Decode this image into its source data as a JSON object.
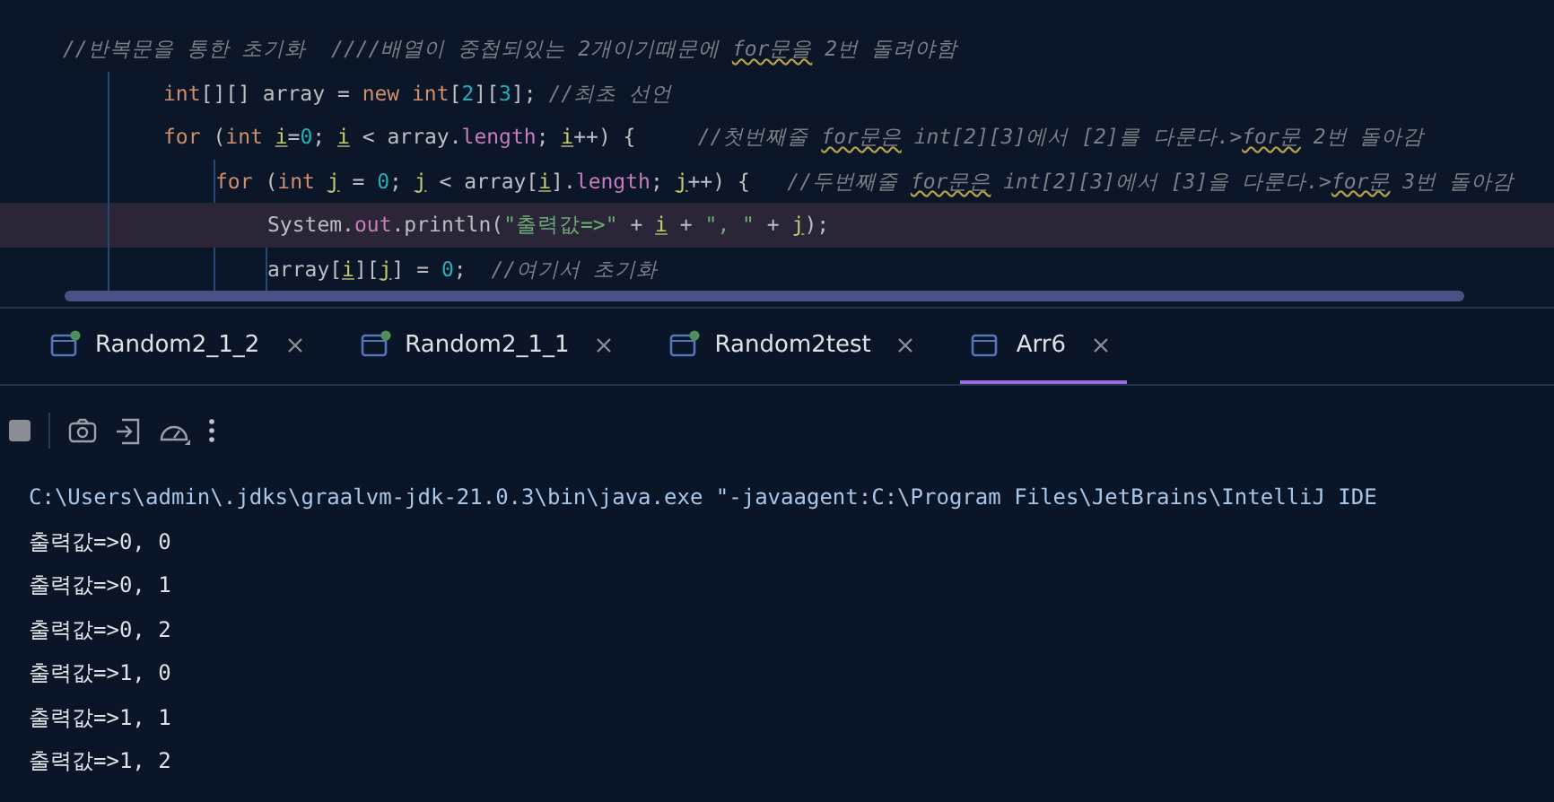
{
  "editor": {
    "lines": [
      {
        "current": false,
        "tokens": [
          {
            "kind": "comment",
            "text": "//반복문을 통한 초기화  ////배열이 중첩되있는 2개이기때문에 "
          },
          {
            "kind": "typo",
            "text": "for문을"
          },
          {
            "kind": "comment",
            "text": " 2번 돌려야함"
          }
        ],
        "children": [
          {
            "current": false,
            "tokens": [
              {
                "kind": "keyword",
                "text": "int"
              },
              {
                "kind": "plain",
                "text": "[][] "
              },
              {
                "kind": "variable",
                "text": "array"
              },
              {
                "kind": "plain",
                "text": " = "
              },
              {
                "kind": "keyword",
                "text": "new int"
              },
              {
                "kind": "plain",
                "text": "["
              },
              {
                "kind": "number",
                "text": "2"
              },
              {
                "kind": "plain",
                "text": "]["
              },
              {
                "kind": "number",
                "text": "3"
              },
              {
                "kind": "plain",
                "text": "]; "
              },
              {
                "kind": "comment",
                "text": "//최초 선언"
              }
            ]
          },
          {
            "current": false,
            "tokens": [
              {
                "kind": "keyword",
                "text": "for"
              },
              {
                "kind": "plain",
                "text": " ("
              },
              {
                "kind": "keyword",
                "text": "int "
              },
              {
                "kind": "loopvar",
                "text": "i"
              },
              {
                "kind": "plain",
                "text": "="
              },
              {
                "kind": "number",
                "text": "0"
              },
              {
                "kind": "plain",
                "text": "; "
              },
              {
                "kind": "loopvar",
                "text": "i"
              },
              {
                "kind": "plain",
                "text": " < array."
              },
              {
                "kind": "field",
                "text": "length"
              },
              {
                "kind": "plain",
                "text": "; "
              },
              {
                "kind": "loopvar",
                "text": "i"
              },
              {
                "kind": "plain",
                "text": "++) {     "
              },
              {
                "kind": "comment",
                "text": "//첫번째줄 "
              },
              {
                "kind": "typo",
                "text": "for문은"
              },
              {
                "kind": "comment",
                "text": " int[2][3]에서 [2]를 다룬다.>"
              },
              {
                "kind": "typo",
                "text": "for문"
              },
              {
                "kind": "comment",
                "text": " 2번 돌아감"
              }
            ],
            "children": [
              {
                "current": false,
                "tokens": [
                  {
                    "kind": "keyword",
                    "text": "for"
                  },
                  {
                    "kind": "plain",
                    "text": " ("
                  },
                  {
                    "kind": "keyword",
                    "text": "int "
                  },
                  {
                    "kind": "loopvar",
                    "text": "j"
                  },
                  {
                    "kind": "plain",
                    "text": " = "
                  },
                  {
                    "kind": "number",
                    "text": "0"
                  },
                  {
                    "kind": "plain",
                    "text": "; "
                  },
                  {
                    "kind": "loopvar",
                    "text": "j"
                  },
                  {
                    "kind": "plain",
                    "text": " < array["
                  },
                  {
                    "kind": "loopvar",
                    "text": "i"
                  },
                  {
                    "kind": "plain",
                    "text": "]."
                  },
                  {
                    "kind": "field",
                    "text": "length"
                  },
                  {
                    "kind": "plain",
                    "text": "; "
                  },
                  {
                    "kind": "loopvar",
                    "text": "j"
                  },
                  {
                    "kind": "plain",
                    "text": "++) {   "
                  },
                  {
                    "kind": "comment",
                    "text": "//두번째줄 "
                  },
                  {
                    "kind": "typo",
                    "text": "for문은"
                  },
                  {
                    "kind": "comment",
                    "text": " int[2][3]에서 [3]을 다룬다.>"
                  },
                  {
                    "kind": "typo",
                    "text": "for문"
                  },
                  {
                    "kind": "comment",
                    "text": " 3번 돌아감"
                  }
                ],
                "children": [
                  {
                    "current": true,
                    "tokens": [
                      {
                        "kind": "plain",
                        "text": "System."
                      },
                      {
                        "kind": "field",
                        "text": "out"
                      },
                      {
                        "kind": "plain",
                        "text": ".println("
                      },
                      {
                        "kind": "string",
                        "text": "\"출력값=>\""
                      },
                      {
                        "kind": "plain",
                        "text": " + "
                      },
                      {
                        "kind": "loopvar",
                        "text": "i"
                      },
                      {
                        "kind": "plain",
                        "text": " + "
                      },
                      {
                        "kind": "string",
                        "text": "\", \""
                      },
                      {
                        "kind": "plain",
                        "text": " + "
                      },
                      {
                        "kind": "loopvar",
                        "text": "j"
                      },
                      {
                        "kind": "plain",
                        "text": ");"
                      }
                    ]
                  },
                  {
                    "current": false,
                    "tokens": [
                      {
                        "kind": "plain",
                        "text": "array["
                      },
                      {
                        "kind": "loopvar",
                        "text": "i"
                      },
                      {
                        "kind": "plain",
                        "text": "]["
                      },
                      {
                        "kind": "loopvar",
                        "text": "j"
                      },
                      {
                        "kind": "plain",
                        "text": "] = "
                      },
                      {
                        "kind": "number",
                        "text": "0"
                      },
                      {
                        "kind": "plain",
                        "text": ";  "
                      },
                      {
                        "kind": "comment",
                        "text": "//여기서 초기화"
                      }
                    ]
                  }
                ]
              }
            ]
          }
        ]
      }
    ]
  },
  "tabs": [
    {
      "label": "Random2_1_2",
      "running": true,
      "selected": false
    },
    {
      "label": "Random2_1_1",
      "running": true,
      "selected": false
    },
    {
      "label": "Random2test",
      "running": true,
      "selected": false
    },
    {
      "label": "Arr6",
      "running": false,
      "selected": true
    }
  ],
  "console": {
    "command": "C:\\Users\\admin\\.jdks\\graalvm-jdk-21.0.3\\bin\\java.exe \"-javaagent:C:\\Program Files\\JetBrains\\IntelliJ IDE",
    "output": [
      "출력값=>0, 0",
      "출력값=>0, 1",
      "출력값=>0, 2",
      "출력값=>1, 0",
      "출력값=>1, 1",
      "출력값=>1, 2"
    ]
  }
}
